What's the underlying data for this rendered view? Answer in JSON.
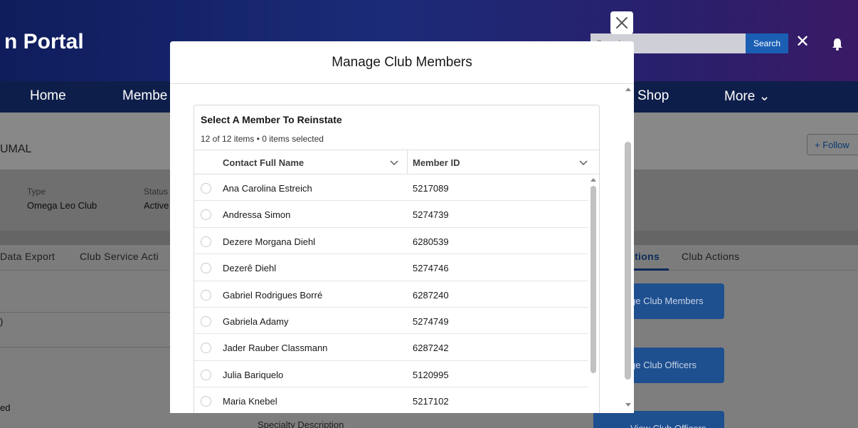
{
  "app": {
    "title": "n Portal",
    "search_placeholder": "Search...",
    "search_label": "Search"
  },
  "nav": {
    "items": [
      "Home",
      "Membe",
      "Shop",
      "More ⌄"
    ]
  },
  "record": {
    "name": "UMAL",
    "follow_label": "+ Follow",
    "type_label": "Type",
    "type_value": "Omega Leo Club",
    "status_label": "Status",
    "status_value": "Active",
    "left_tab_1": "Data Export",
    "left_tab_2": "Club Service Acti",
    "right_tab_1": "ctions",
    "right_tab_2": "Club Actions",
    "action_1": "ge Club Members",
    "action_2": "ge Club Officers",
    "action_3": "View Club Officers",
    "lower_left_1": ")",
    "lower_left_2": "ed",
    "specialty": "Specialty Description"
  },
  "modal": {
    "title": "Manage Club Members",
    "card_title": "Select A Member To Reinstate",
    "count_text": "12 of 12 items • 0 items selected",
    "columns": [
      "Contact Full Name",
      "Member ID"
    ],
    "rows": [
      {
        "name": "Ana Carolina Estreich",
        "id": "5217089"
      },
      {
        "name": "Andressa Simon",
        "id": "5274739"
      },
      {
        "name": "Dezere Morgana Diehl",
        "id": "6280539"
      },
      {
        "name": "Dezerê Diehl",
        "id": "5274746"
      },
      {
        "name": "Gabriel Rodrigues Borré",
        "id": "6287240"
      },
      {
        "name": "Gabriela Adamy",
        "id": "5274749"
      },
      {
        "name": "Jader Rauber Classmann",
        "id": "6287242"
      },
      {
        "name": "Julia Bariquelo",
        "id": "5120995"
      },
      {
        "name": "Maria Knebel",
        "id": "5217102"
      }
    ]
  },
  "colors": {
    "header_start": "#0f1d5c",
    "nav": "#0e1e4a",
    "button_blue": "#1b5fb5",
    "action_blue": "#1e4f8f"
  }
}
